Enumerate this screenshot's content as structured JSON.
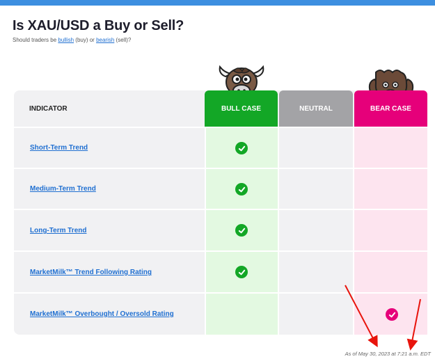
{
  "header": {
    "title": "Is XAU/USD a Buy or Sell?",
    "subtitle_prefix": "Should traders be ",
    "bullish_link": "bullish",
    "subtitle_mid1": " (buy) or ",
    "bearish_link": "bearish",
    "subtitle_mid2": " (sell)?"
  },
  "table": {
    "headers": {
      "indicator": "INDICATOR",
      "bull": "BULL CASE",
      "neutral": "NEUTRAL",
      "bear": "BEAR CASE"
    },
    "rows": [
      {
        "label": "Short-Term Trend",
        "signal": "bull"
      },
      {
        "label": "Medium-Term Trend",
        "signal": "bull"
      },
      {
        "label": "Long-Term Trend",
        "signal": "bull"
      },
      {
        "label": "MarketMilk™ Trend Following Rating",
        "signal": "bull"
      },
      {
        "label_part1": "MarketMilk™ Overbought",
        "label_sep": " / ",
        "label_part2": "Oversold Rating",
        "signal": "bear"
      }
    ]
  },
  "footer": {
    "as_of": "As of May 30, 2023 at 7:21 a.m. EDT"
  },
  "colors": {
    "accent_blue": "#3d8fe0",
    "bull_green": "#13a726",
    "bear_pink": "#e6007a",
    "neutral_gray": "#a3a3a6",
    "arrow_red": "#e8140c"
  },
  "icons": [
    "bull-mascot-icon",
    "bear-mascot-icon",
    "checkmark-icon",
    "red-arrow-annotation"
  ]
}
